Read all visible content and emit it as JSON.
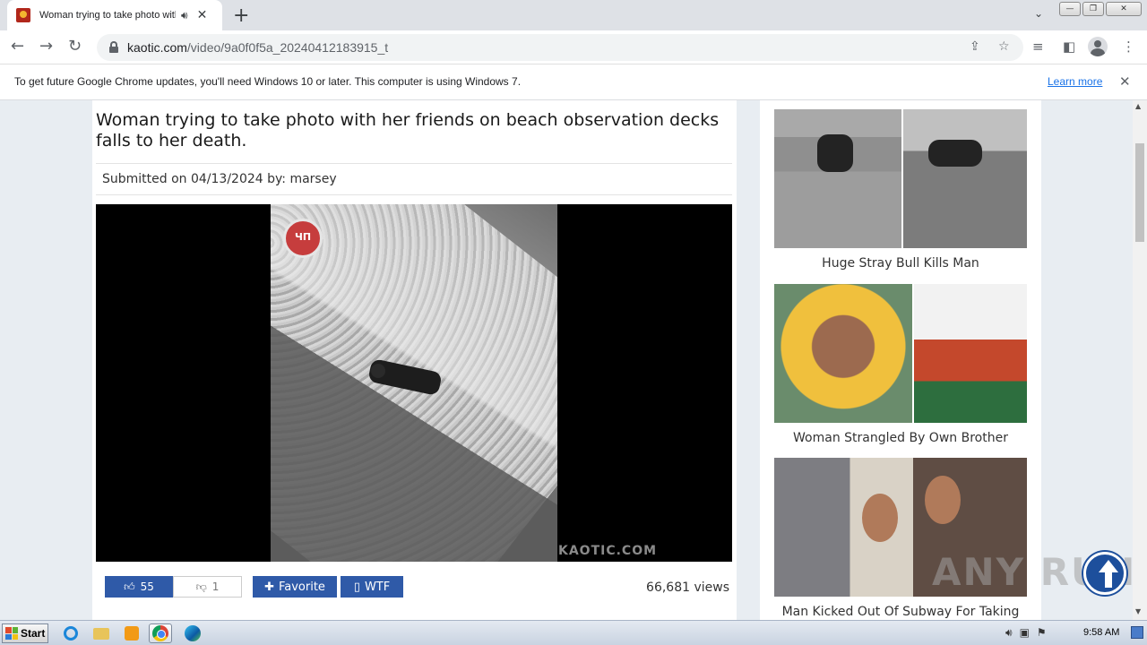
{
  "browser": {
    "tab_title": "Woman trying to take photo with her friends",
    "tab_audio_icon": "speaker-icon",
    "new_tab_label": "+",
    "url_host": "kaotic.com",
    "url_path": "/video/9a0f0f5a_20240412183915_t"
  },
  "infobar": {
    "message": "To get future Google Chrome updates, you'll need Windows 10 or later. This computer is using Windows 7.",
    "learn_more": "Learn more"
  },
  "article": {
    "title": "Woman trying to take photo with her friends on beach observation decks falls to her death.",
    "submitted": "Submitted on 04/13/2024 by:  marsey",
    "video_watermark": "KAOTIC.COM",
    "channel_logo_text": "ЧП"
  },
  "actions": {
    "likes": "55",
    "dislikes": "1",
    "favorite_label": "Favorite",
    "wtf_label": "WTF",
    "views": "66,681 views"
  },
  "sidebar": {
    "items": [
      {
        "label": "Huge Stray Bull Kills Man"
      },
      {
        "label": "Woman Strangled By Own Brother"
      },
      {
        "label": "Man Kicked Out Of Subway For Taking"
      }
    ]
  },
  "watermark": "ANY RUN",
  "taskbar": {
    "start_label": "Start",
    "clock": "9:58 AM"
  },
  "colors": {
    "accent_button": "#2f5aa8",
    "link": "#1a73e8",
    "scroll_top": "#1d4f9c"
  }
}
